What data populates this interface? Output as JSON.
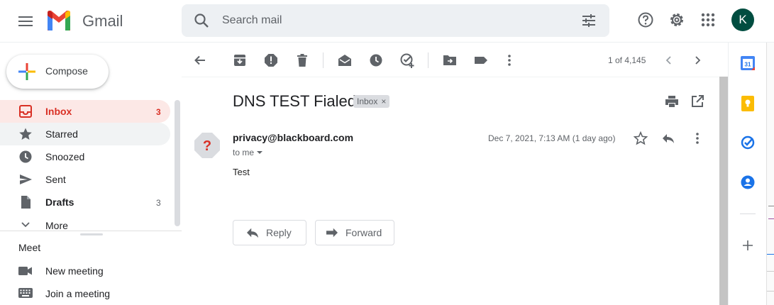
{
  "app": {
    "name": "Gmail",
    "avatar_letter": "K"
  },
  "search": {
    "placeholder": "Search mail"
  },
  "compose": {
    "label": "Compose"
  },
  "nav": {
    "items": [
      {
        "label": "Inbox",
        "count": "3",
        "icon": "inbox-icon"
      },
      {
        "label": "Starred",
        "count": "",
        "icon": "star-icon"
      },
      {
        "label": "Snoozed",
        "count": "",
        "icon": "clock-icon"
      },
      {
        "label": "Sent",
        "count": "",
        "icon": "send-icon"
      },
      {
        "label": "Drafts",
        "count": "3",
        "icon": "draft-icon"
      },
      {
        "label": "More",
        "count": "",
        "icon": "chevron-down-icon"
      }
    ]
  },
  "meet": {
    "title": "Meet",
    "items": [
      {
        "label": "New meeting",
        "icon": "video-icon"
      },
      {
        "label": "Join a meeting",
        "icon": "keyboard-icon"
      }
    ]
  },
  "toolbar": {
    "pager": "1 of 4,145"
  },
  "email": {
    "subject": "DNS TEST Fialed",
    "label": "Inbox",
    "sender": "privacy@blackboard.com",
    "recipient": "to me",
    "date": "Dec 7, 2021, 7:13 AM (1 day ago)",
    "body": "Test"
  },
  "actions": {
    "reply": "Reply",
    "forward": "Forward"
  },
  "side_panel": {
    "calendar_day": "31"
  },
  "colors": {
    "inbox_active_bg": "#fce8e6",
    "inbox_active_text": "#d93025",
    "avatar_bg": "#004d40",
    "unknown_sender": "#d93025"
  }
}
